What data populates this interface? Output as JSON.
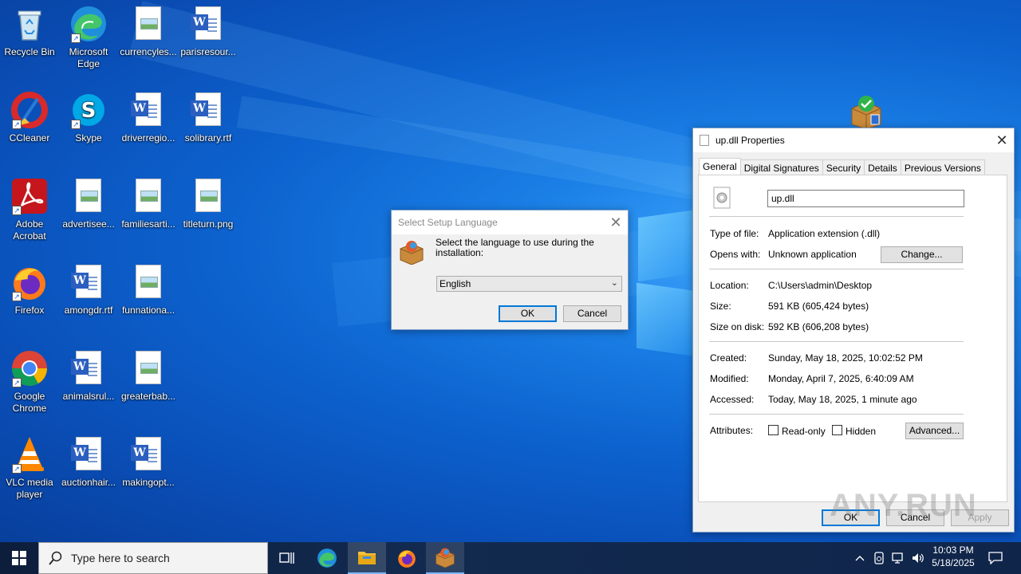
{
  "desktop": {
    "icons": [
      {
        "label": "Recycle Bin",
        "icon": "recycle-bin-icon"
      },
      {
        "label": "Microsoft Edge",
        "icon": "edge-icon"
      },
      {
        "label": "currencyles...",
        "icon": "image-file-icon"
      },
      {
        "label": "parisresour...",
        "icon": "word-doc-icon"
      },
      {
        "label": "CCleaner",
        "icon": "ccleaner-icon"
      },
      {
        "label": "Skype",
        "icon": "skype-icon"
      },
      {
        "label": "driverregio...",
        "icon": "word-doc-icon"
      },
      {
        "label": "solibrary.rtf",
        "icon": "word-doc-icon"
      },
      {
        "label": "Adobe Acrobat",
        "icon": "acrobat-icon"
      },
      {
        "label": "advertisee...",
        "icon": "image-file-icon"
      },
      {
        "label": "familiesarti...",
        "icon": "image-file-icon"
      },
      {
        "label": "titleturn.png",
        "icon": "image-file-icon"
      },
      {
        "label": "Firefox",
        "icon": "firefox-icon"
      },
      {
        "label": "amongdr.rtf",
        "icon": "word-doc-icon"
      },
      {
        "label": "funnationa...",
        "icon": "image-file-icon"
      },
      {
        "label": "Google Chrome",
        "icon": "chrome-icon"
      },
      {
        "label": "animalsrul...",
        "icon": "word-doc-icon"
      },
      {
        "label": "greaterbab...",
        "icon": "image-file-icon"
      },
      {
        "label": "VLC media player",
        "icon": "vlc-icon"
      },
      {
        "label": "auctionhair...",
        "icon": "word-doc-icon"
      },
      {
        "label": "makingopt...",
        "icon": "word-doc-icon"
      }
    ]
  },
  "setup_dialog": {
    "title": "Select Setup Language",
    "prompt": "Select the language to use during the installation:",
    "language_selected": "English",
    "ok_label": "OK",
    "cancel_label": "Cancel"
  },
  "properties_dialog": {
    "title": "up.dll Properties",
    "tabs": [
      "General",
      "Digital Signatures",
      "Security",
      "Details",
      "Previous Versions"
    ],
    "active_tab": "General",
    "filename": "up.dll",
    "type_label": "Type of file:",
    "type_value": "Application extension (.dll)",
    "opens_label": "Opens with:",
    "opens_value": "Unknown application",
    "change_label": "Change...",
    "location_label": "Location:",
    "location_value": "C:\\Users\\admin\\Desktop",
    "size_label": "Size:",
    "size_value": "591 KB (605,424 bytes)",
    "size_disk_label": "Size on disk:",
    "size_disk_value": "592 KB (606,208 bytes)",
    "created_label": "Created:",
    "created_value": "Sunday, May 18, 2025, 10:02:52 PM",
    "modified_label": "Modified:",
    "modified_value": "Monday, April 7, 2025, 6:40:09 AM",
    "accessed_label": "Accessed:",
    "accessed_value": "Today, May 18, 2025, 1 minute ago",
    "attributes_label": "Attributes:",
    "readonly_label": "Read-only",
    "hidden_label": "Hidden",
    "advanced_label": "Advanced...",
    "ok_label": "OK",
    "cancel_label": "Cancel",
    "apply_label": "Apply"
  },
  "taskbar": {
    "search_placeholder": "Type here to search",
    "time": "10:03 PM",
    "date": "5/18/2025"
  },
  "watermark": "ANY.RUN"
}
